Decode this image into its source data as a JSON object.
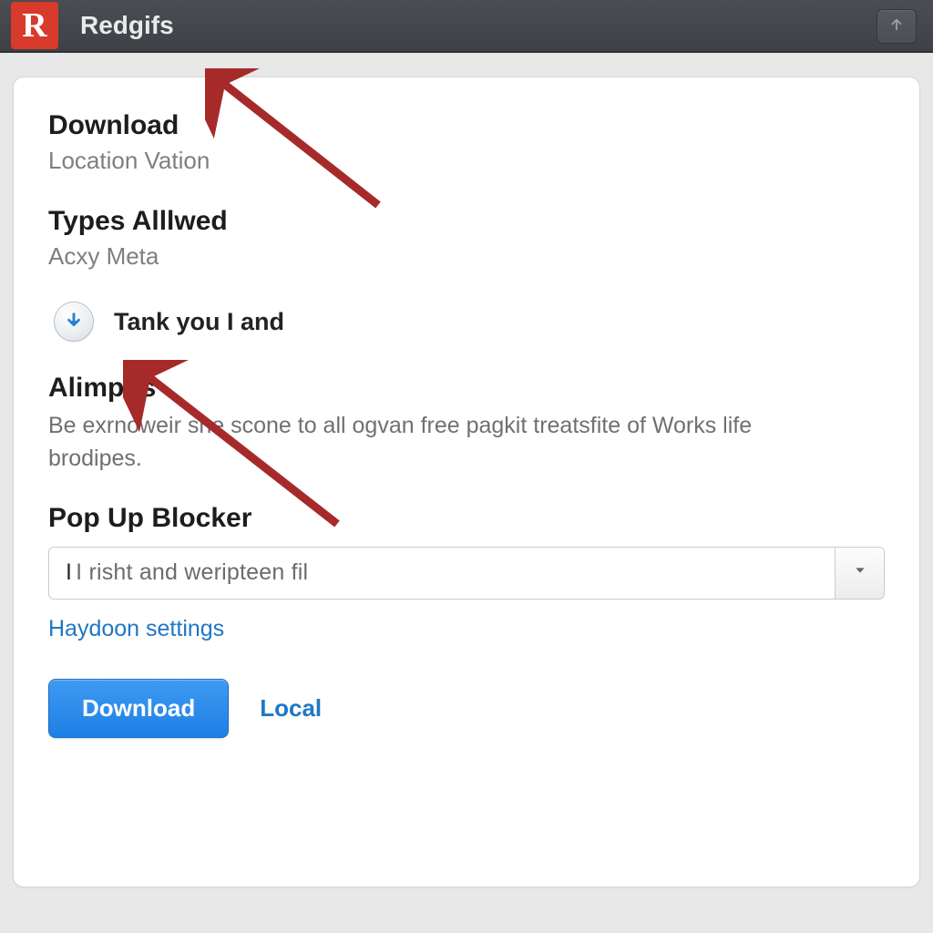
{
  "app": {
    "logo_letter": "R",
    "title": "Redgifs"
  },
  "sections": {
    "download": {
      "heading": "Download",
      "subtitle": "Location Vation"
    },
    "types": {
      "heading": "Types Alllwed",
      "subtitle": "Acxy Meta"
    },
    "info_row": {
      "text": "Tank you I and"
    },
    "alimpus": {
      "heading": "Alimpus",
      "body": "Be exrnoweir she scone to all ogvan free pagkit treatsfite of Works life brodipes."
    },
    "popup": {
      "heading": "Pop Up Blocker",
      "dropdown_value": "I risht and weripteen fil"
    }
  },
  "links": {
    "settings": "Haydoon settings"
  },
  "actions": {
    "download_button": "Download",
    "local_label": "Local"
  },
  "colors": {
    "brand_red": "#d83a2b",
    "link_blue": "#1f77c4",
    "button_blue": "#2a89e8",
    "arrow_red": "#a62a2a"
  }
}
